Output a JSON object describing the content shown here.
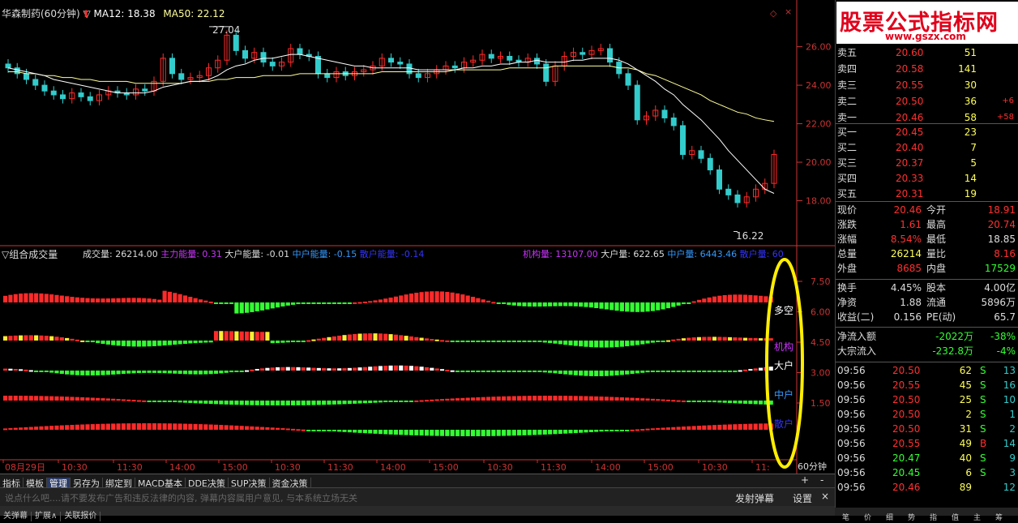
{
  "main_title": {
    "stock": "华森制药(60分钟)",
    "ma12_label": "MA12: 18.38",
    "ma50_label": "MA50: 22.12"
  },
  "annotations": {
    "high": "27.04",
    "low": "16.22"
  },
  "sub_title": "组合成交量",
  "sub_legend": {
    "vol": "成交量: 26214.00",
    "main_energy": "主力能量: 0.31",
    "big_energy": "大户能量: -0.01",
    "mid_energy": "中户能量: -0.15",
    "retail_energy": "散户能量: -0.14",
    "inst_vol": "机构量: 13107.00",
    "big_vol": "大户量: 622.65",
    "mid_vol": "中户量: 6443.46",
    "retail_vol": "散户量: 60"
  },
  "row_labels": {
    "longshort": "多空",
    "inst": "机构",
    "big": "大户",
    "mid": "中户",
    "retail": "散户"
  },
  "period_label": "60分钟",
  "colors": {
    "up": "#ff2a2a",
    "down": "#33ff33",
    "ma12": "#ffffff",
    "ma50": "#ffff99",
    "yellow": "#ffee33",
    "highlight": "#ffee00",
    "axis": "#cc3333"
  },
  "chart_data": {
    "type": "candlestick",
    "y_axis_price": [
      "26.00",
      "24.00",
      "22.00",
      "20.00",
      "18.00"
    ],
    "price_ylim": [
      16.0,
      27.5
    ],
    "y_axis_sub": [
      "7.50",
      "6.00",
      "4.50",
      "3.00",
      "1.50"
    ],
    "x_labels": [
      "08月29日",
      "10:30",
      "11:30",
      "14:00",
      "15:00",
      "10:30",
      "11:30",
      "14:00",
      "15:00",
      "10:30",
      "11:30",
      "14:00",
      "15:00",
      "10:30",
      "11:"
    ],
    "close": [
      24.9,
      24.6,
      24.3,
      24.0,
      23.7,
      23.5,
      23.3,
      23.6,
      23.4,
      23.2,
      23.5,
      23.7,
      23.6,
      23.5,
      23.8,
      23.7,
      24.2,
      25.4,
      24.6,
      24.3,
      24.4,
      24.5,
      24.9,
      25.3,
      26.6,
      25.8,
      25.4,
      25.7,
      25.2,
      25.0,
      25.2,
      25.9,
      25.6,
      25.5,
      24.6,
      24.4,
      24.7,
      24.5,
      24.7,
      24.8,
      25.0,
      25.4,
      25.2,
      25.1,
      24.6,
      24.4,
      24.6,
      24.8,
      25.0,
      24.9,
      25.2,
      25.3,
      25.6,
      25.4,
      25.5,
      25.3,
      25.2,
      25.4,
      25.1,
      24.2,
      25.0,
      25.5,
      25.7,
      25.6,
      25.8,
      25.9,
      25.2,
      24.6,
      24.0,
      22.2,
      22.4,
      22.7,
      22.3,
      21.9,
      20.4,
      20.6,
      20.2,
      19.6,
      18.6,
      18.3,
      17.9,
      18.2,
      18.6,
      18.9,
      20.4
    ],
    "ma12": [
      24.9,
      24.8,
      24.7,
      24.6,
      24.5,
      24.3,
      24.2,
      24.1,
      24.0,
      23.9,
      23.8,
      23.7,
      23.6,
      23.6,
      23.6,
      23.6,
      23.7,
      23.9,
      24.0,
      24.1,
      24.2,
      24.2,
      24.3,
      24.5,
      24.8,
      25.0,
      25.1,
      25.3,
      25.4,
      25.4,
      25.5,
      25.6,
      25.6,
      25.5,
      25.4,
      25.3,
      25.2,
      25.1,
      25.0,
      25.0,
      24.9,
      24.9,
      24.9,
      24.9,
      24.9,
      24.8,
      24.8,
      24.8,
      24.8,
      24.8,
      24.9,
      24.9,
      25.0,
      25.0,
      25.1,
      25.1,
      25.2,
      25.2,
      25.3,
      25.2,
      25.2,
      25.2,
      25.3,
      25.3,
      25.4,
      25.4,
      25.4,
      25.3,
      25.1,
      24.8,
      24.5,
      24.2,
      23.8,
      23.5,
      23.0,
      22.6,
      22.2,
      21.7,
      21.2,
      20.6,
      20.1,
      19.6,
      19.1,
      18.6,
      18.38
    ],
    "ma50": [
      24.7,
      24.7,
      24.6,
      24.6,
      24.5,
      24.5,
      24.4,
      24.4,
      24.3,
      24.3,
      24.2,
      24.2,
      24.2,
      24.2,
      24.1,
      24.1,
      24.1,
      24.1,
      24.1,
      24.1,
      24.2,
      24.2,
      24.2,
      24.3,
      24.3,
      24.4,
      24.4,
      24.4,
      24.5,
      24.5,
      24.5,
      24.5,
      24.6,
      24.6,
      24.6,
      24.6,
      24.6,
      24.6,
      24.6,
      24.6,
      24.6,
      24.7,
      24.7,
      24.7,
      24.7,
      24.7,
      24.7,
      24.7,
      24.7,
      24.8,
      24.8,
      24.8,
      24.8,
      24.8,
      24.8,
      24.9,
      24.9,
      24.9,
      24.9,
      24.9,
      25.0,
      25.0,
      25.0,
      25.0,
      25.0,
      25.0,
      25.0,
      24.9,
      24.9,
      24.8,
      24.6,
      24.5,
      24.3,
      24.1,
      23.9,
      23.7,
      23.5,
      23.2,
      23.0,
      22.8,
      22.6,
      22.5,
      22.3,
      22.2,
      22.12
    ]
  },
  "bottom_tabs": [
    "指标",
    "模板",
    "管理",
    "另存为",
    "绑定到",
    "MACD基本",
    "DDE决策",
    "SUP决策",
    "资金决策"
  ],
  "bottom_right": {
    "plus": "+",
    "minus": "-"
  },
  "msg_hint": "说点什么吧....请不要发布广告和违反法律的内容, 弹幕内容属用户意见, 与本系统立场无关",
  "msg_send": "发射弹幕",
  "msg_settings": "设置",
  "msg_close": "×",
  "footer": [
    "关弹幕",
    "扩展∧",
    "关联报价"
  ],
  "watermark": {
    "title": "股票公式指标网",
    "url": "www.gszx.com"
  },
  "order_book": {
    "sell": [
      {
        "label": "卖五",
        "price": "20.60",
        "vol": "51",
        "chg": ""
      },
      {
        "label": "卖四",
        "price": "20.58",
        "vol": "141",
        "chg": ""
      },
      {
        "label": "卖三",
        "price": "20.55",
        "vol": "30",
        "chg": ""
      },
      {
        "label": "卖二",
        "price": "20.50",
        "vol": "36",
        "chg": "+6"
      },
      {
        "label": "卖一",
        "price": "20.46",
        "vol": "58",
        "chg": "+58"
      }
    ],
    "buy": [
      {
        "label": "买一",
        "price": "20.45",
        "vol": "23"
      },
      {
        "label": "买二",
        "price": "20.40",
        "vol": "7"
      },
      {
        "label": "买三",
        "price": "20.37",
        "vol": "5"
      },
      {
        "label": "买四",
        "price": "20.33",
        "vol": "14"
      },
      {
        "label": "买五",
        "price": "20.31",
        "vol": "19"
      }
    ]
  },
  "quote": [
    {
      "l1": "现价",
      "v1": "20.46",
      "c1": "red",
      "l2": "今开",
      "v2": "18.91",
      "c2": "red"
    },
    {
      "l1": "涨跌",
      "v1": "1.61",
      "c1": "red",
      "l2": "最高",
      "v2": "20.74",
      "c2": "red"
    },
    {
      "l1": "涨幅",
      "v1": "8.54%",
      "c1": "red",
      "l2": "最低",
      "v2": "18.85",
      "c2": "wht"
    },
    {
      "l1": "总量",
      "v1": "26214",
      "c1": "yel",
      "l2": "量比",
      "v2": "8.16",
      "c2": "red"
    },
    {
      "l1": "外盘",
      "v1": "8685",
      "c1": "red",
      "l2": "内盘",
      "v2": "17529",
      "c2": "grn"
    }
  ],
  "fund": [
    {
      "l1": "换手",
      "v1": "4.45%",
      "l2": "股本",
      "v2": "4.00亿"
    },
    {
      "l1": "净资",
      "v1": "1.88",
      "l2": "流通",
      "v2": "5896万"
    },
    {
      "l1": "收益(二)",
      "v1": "0.156",
      "l2": "PE(动)",
      "v2": "65.7"
    }
  ],
  "flow": [
    {
      "l": "净流入额",
      "v": "-2022万",
      "p": "-38%"
    },
    {
      "l": "大宗流入",
      "v": "-232.8万",
      "p": "-4%"
    }
  ],
  "ticks": [
    {
      "t": "09:56",
      "p": "20.50",
      "v": "62",
      "s": "S",
      "n": "13"
    },
    {
      "t": "09:56",
      "p": "20.55",
      "v": "45",
      "s": "S",
      "n": "16"
    },
    {
      "t": "09:56",
      "p": "20.50",
      "v": "25",
      "s": "S",
      "n": "10"
    },
    {
      "t": "09:56",
      "p": "20.50",
      "v": "2",
      "s": "S",
      "n": "1"
    },
    {
      "t": "09:56",
      "p": "20.50",
      "v": "31",
      "s": "S",
      "n": "2"
    },
    {
      "t": "09:56",
      "p": "20.55",
      "v": "49",
      "s": "B",
      "n": "14"
    },
    {
      "t": "09:56",
      "p": "20.47",
      "v": "40",
      "s": "S",
      "n": "9"
    },
    {
      "t": "09:56",
      "p": "20.45",
      "v": "6",
      "s": "S",
      "n": "3"
    },
    {
      "t": "09:56",
      "p": "20.46",
      "v": "89",
      "s": "",
      "n": "12"
    }
  ],
  "side_tabs": [
    "笔",
    "价",
    "细",
    "势",
    "指",
    "值",
    "主",
    "筹"
  ]
}
